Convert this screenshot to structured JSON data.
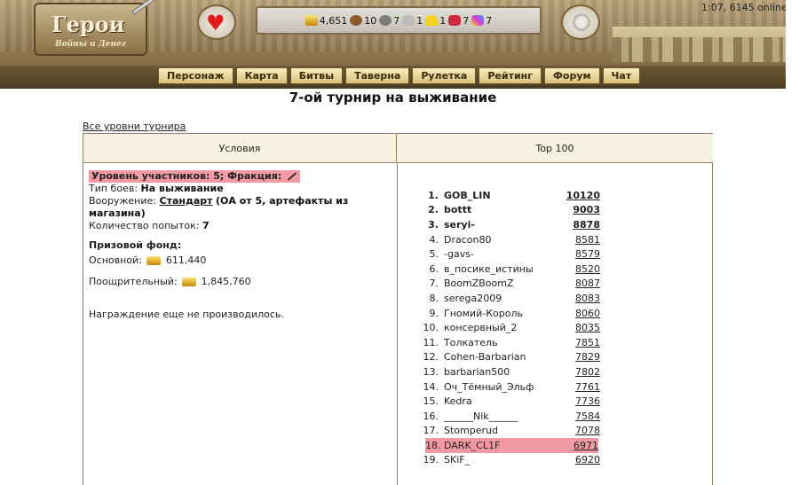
{
  "header": {
    "logo_title": "Герои",
    "logo_subtitle": "Войны и Денег",
    "clock": "1:07, 6145 online",
    "resources": [
      {
        "icon": "gold-icon",
        "value": "4,651"
      },
      {
        "icon": "wood-icon",
        "value": "10"
      },
      {
        "icon": "ore-icon",
        "value": "7"
      },
      {
        "icon": "mercury-icon",
        "value": "1"
      },
      {
        "icon": "sulfur-icon",
        "value": "1"
      },
      {
        "icon": "crystal-icon",
        "value": "7"
      },
      {
        "icon": "gems-icon",
        "value": "7"
      }
    ],
    "nav": [
      "Персонаж",
      "Карта",
      "Битвы",
      "Таверна",
      "Рулетка",
      "Рейтинг",
      "Форум",
      "Чат"
    ]
  },
  "page": {
    "title": "7-ой турнир на выживание",
    "all_levels_link": "Все уровни турнира"
  },
  "table": {
    "col_conditions": "Условия",
    "col_top": "Top 100"
  },
  "conditions": {
    "level_line": "Уровень участников: 5;  Фракция:",
    "battle_type_label": "Тип боев:",
    "battle_type_value": "На выживание",
    "armament_label": "Вооружение:",
    "armament_link": "Стандарт",
    "armament_note": "(ОА от 5, артефакты из магазина)",
    "attempts_label": "Количество попыток:",
    "attempts_value": "7",
    "prize_title": "Призовой фонд:",
    "main_prize_label": "Основной:",
    "main_prize_value": "611,440",
    "incentive_label": "Поощрительный:",
    "incentive_value": "1,845,760",
    "award_note": "Награждение еще не производилось."
  },
  "top100": [
    {
      "rank": "1.",
      "player": "GOB_LIN",
      "score": "10120",
      "bold": true
    },
    {
      "rank": "2.",
      "player": "bottt",
      "score": "9003",
      "bold": true
    },
    {
      "rank": "3.",
      "player": "seryi-",
      "score": "8878",
      "bold": true
    },
    {
      "rank": "4.",
      "player": "Dracon80",
      "score": "8581"
    },
    {
      "rank": "5.",
      "player": "-gavs-",
      "score": "8579"
    },
    {
      "rank": "6.",
      "player": "в_посике_истины",
      "score": "8520"
    },
    {
      "rank": "7.",
      "player": "BoomZBoomZ",
      "score": "8087"
    },
    {
      "rank": "8.",
      "player": "serega2009",
      "score": "8083"
    },
    {
      "rank": "9.",
      "player": "Гномий-Король",
      "score": "8060"
    },
    {
      "rank": "10.",
      "player": "консервный_2",
      "score": "8035"
    },
    {
      "rank": "11.",
      "player": "Толкатель",
      "score": "7851"
    },
    {
      "rank": "12.",
      "player": "Cohen-Barbarian",
      "score": "7829"
    },
    {
      "rank": "13.",
      "player": "barbarian500",
      "score": "7802"
    },
    {
      "rank": "14.",
      "player": "Оч_Тёмный_Эльф",
      "score": "7761"
    },
    {
      "rank": "15.",
      "player": "Kedra",
      "score": "7736"
    },
    {
      "rank": "16.",
      "player": "______Nik______",
      "score": "7584"
    },
    {
      "rank": "17.",
      "player": "Stomperud",
      "score": "7078"
    },
    {
      "rank": "18.",
      "player": "DARK_CL1F",
      "score": "6971",
      "highlight": true
    },
    {
      "rank": "19.",
      "player": "SKiF_",
      "score": "6920"
    }
  ]
}
